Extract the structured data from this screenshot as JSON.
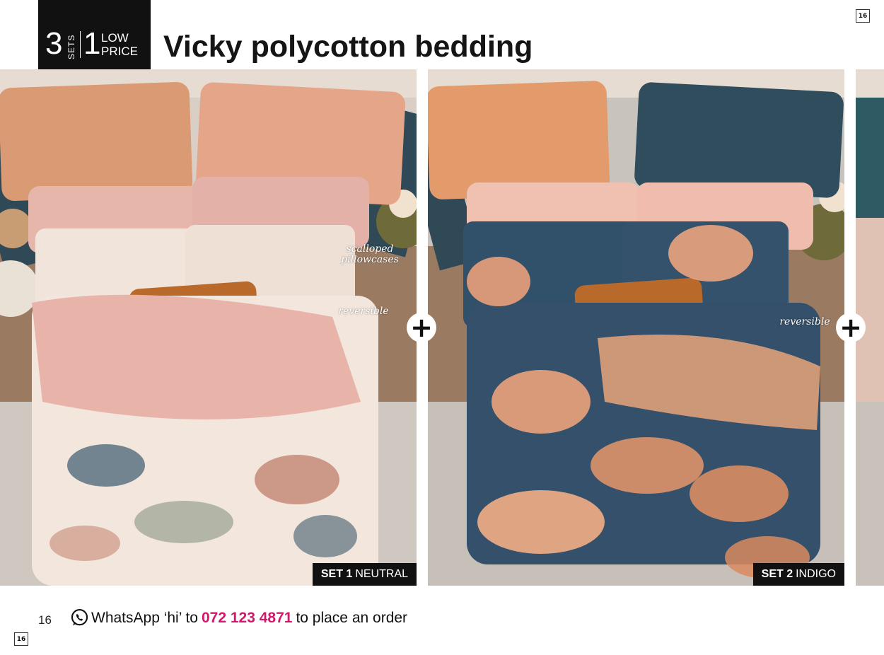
{
  "page": {
    "number_box": "16",
    "page_number": "16"
  },
  "badge": {
    "count_sets": "3",
    "sets_word": "SETS",
    "count_price": "1",
    "low": "LOW",
    "price": "PRICE"
  },
  "title": {
    "brand": "Vicky",
    "rest": "polycotton bedding"
  },
  "sets": [
    {
      "number_label": "SET 1",
      "name": "NEUTRAL"
    },
    {
      "number_label": "SET 2",
      "name": "INDIGO"
    }
  ],
  "notes": {
    "scalloped": "scalloped pillowcases",
    "reversible_1": "reversible",
    "reversible_2": "reversible"
  },
  "plus_symbol": "+",
  "footer": {
    "whatsapp_prefix": "WhatsApp ‘hi’ to",
    "phone": "072 123 4871",
    "whatsapp_suffix": "to place an order"
  },
  "colors": {
    "phone_accent": "#d4176c",
    "badge_bg": "#111111"
  },
  "icons": {
    "whatsapp": "whatsapp-icon",
    "plus": "plus-icon"
  }
}
